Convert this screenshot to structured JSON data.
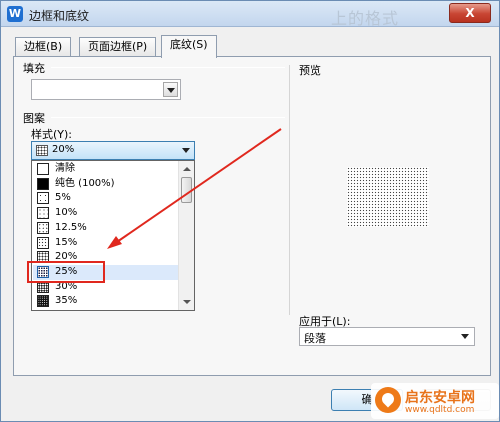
{
  "window": {
    "title": "边框和底纹",
    "ghost_title": "上的格式",
    "close_label": "X"
  },
  "tabs": [
    {
      "label": "边框(B)",
      "active": false
    },
    {
      "label": "页面边框(P)",
      "active": false
    },
    {
      "label": "底纹(S)",
      "active": true
    }
  ],
  "fill": {
    "label": "填充",
    "value": ""
  },
  "pattern": {
    "label": "图案",
    "style_label": "样式(Y):",
    "selected_value": "20%",
    "options": [
      {
        "label": "清除",
        "swatch": "clear"
      },
      {
        "label": "纯色 (100%)",
        "swatch": "solid"
      },
      {
        "label": "5%",
        "swatch": "dots"
      },
      {
        "label": "10%",
        "swatch": "dots"
      },
      {
        "label": "12.5%",
        "swatch": "dots"
      },
      {
        "label": "15%",
        "swatch": "dots"
      },
      {
        "label": "20%",
        "swatch": "dots"
      },
      {
        "label": "25%",
        "swatch": "dots",
        "selected": true
      },
      {
        "label": "30%",
        "swatch": "dots"
      },
      {
        "label": "35%",
        "swatch": "dots"
      }
    ]
  },
  "preview": {
    "label": "预览"
  },
  "apply": {
    "label": "应用于(L):",
    "value": "段落"
  },
  "buttons": {
    "ok_label": "确",
    "cancel_label": ""
  },
  "watermark": {
    "title": "启东安卓网",
    "url": "www.qdltd.com"
  },
  "colors": {
    "annotation_red": "#e0281e",
    "selection_bg": "#dbe9fb",
    "titlebar": "#c3d6ee"
  }
}
